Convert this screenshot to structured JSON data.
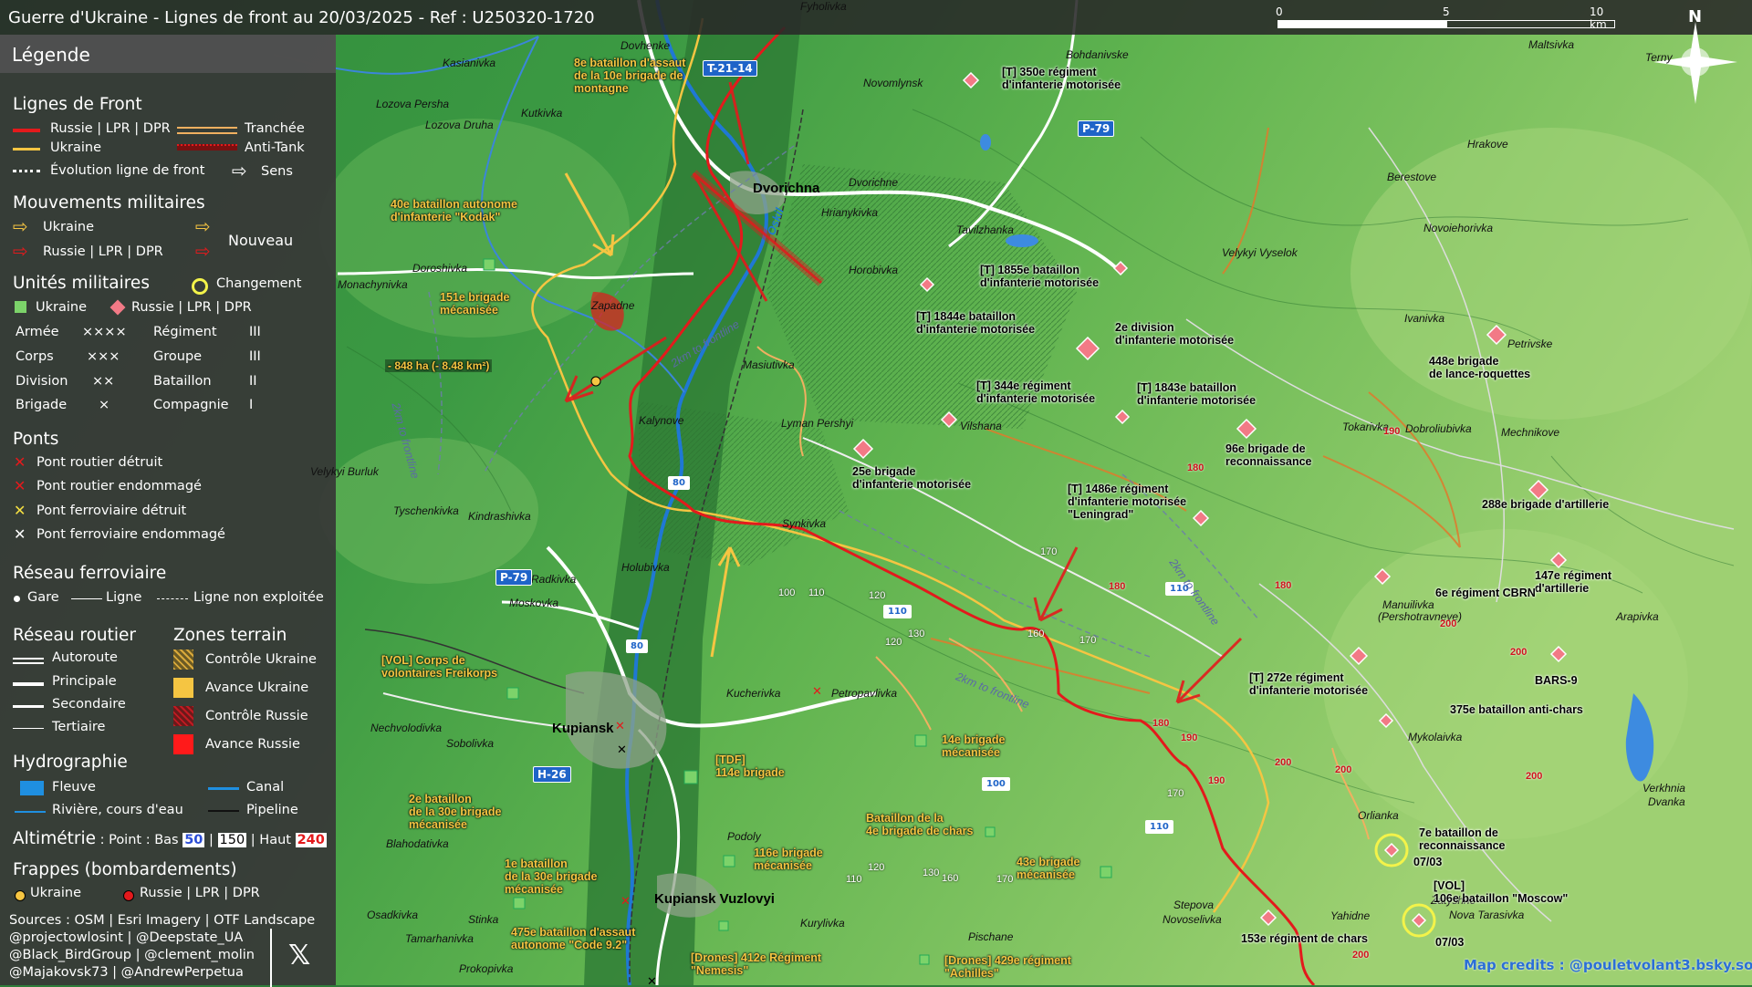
{
  "title": "Guerre d'Ukraine - Lignes de front au 20/03/2025 - Ref : U250320-1720",
  "scale": {
    "ticks": [
      "0",
      "5",
      "10 km"
    ]
  },
  "north": "N",
  "legend": {
    "heading": "Légende",
    "front_lines": {
      "title": "Lignes de Front",
      "russia": "Russie | LPR | DPR",
      "ukraine": "Ukraine",
      "trench": "Tranchée",
      "antitank": "Anti-Tank",
      "evolution": "Évolution ligne de front",
      "direction": "Sens"
    },
    "movements": {
      "title": "Mouvements militaires",
      "ukraine": "Ukraine",
      "russia": "Russie | LPR | DPR",
      "new": "Nouveau"
    },
    "units": {
      "title": "Unités militaires",
      "change": "Changement",
      "ukraine": "Ukraine",
      "russia": "Russie | LPR | DPR",
      "rows": [
        {
          "a": "Armée",
          "as": "××××",
          "b": "Régiment",
          "bs": "III"
        },
        {
          "a": "Corps",
          "as": "×××",
          "b": "Groupe",
          "bs": "III"
        },
        {
          "a": "Division",
          "as": "××",
          "b": "Bataillon",
          "bs": "II"
        },
        {
          "a": "Brigade",
          "as": "×",
          "b": "Compagnie",
          "bs": "I"
        }
      ]
    },
    "bridges": {
      "title": "Ponts",
      "items": [
        "Pont routier détruit",
        "Pont routier endommagé",
        "Pont ferroviaire détruit",
        "Pont ferroviaire endommagé"
      ]
    },
    "rail": {
      "title": "Réseau ferroviaire",
      "station": "Gare",
      "line": "Ligne",
      "unused": "Ligne non exploitée"
    },
    "roads": {
      "title": "Réseau routier",
      "items": [
        "Autoroute",
        "Principale",
        "Secondaire",
        "Tertiaire"
      ]
    },
    "zones": {
      "title": "Zones terrain",
      "items": [
        "Contrôle Ukraine",
        "Avance Ukraine",
        "Contrôle Russie",
        "Avance Russie"
      ]
    },
    "hydro": {
      "title": "Hydrographie",
      "river": "Fleuve",
      "canal": "Canal",
      "stream": "Rivière, cours d'eau",
      "pipeline": "Pipeline"
    },
    "altimetry": {
      "title": "Altimétrie",
      "text": ": Point : Bas",
      "low": "50",
      "sep1": "|",
      "mid": "150",
      "sep2": "| Haut",
      "high": "240"
    },
    "strikes": {
      "title": "Frappes (bombardements)",
      "ukraine": "Ukraine",
      "russia": "Russie | LPR | DPR"
    },
    "sources": [
      "Sources : OSM | Esri Imagery | OTF Landscape",
      "@projectowlosint | @Deepstate_UA",
      "@Black_BirdGroup | @clement_molin",
      "@Majakovsk73 | @AndrewPerpetua"
    ],
    "x_icon": "x-logo-icon"
  },
  "road_badges": [
    "T-21-14",
    "P-79",
    "P-79",
    "H-26",
    "80",
    "80",
    "110",
    "110",
    "110",
    "100"
  ],
  "villages": [
    "Fyholivka",
    "Dovhenke",
    "Kasianivka",
    "Lozova Persha",
    "Lozova Druha",
    "Kutkivka",
    "Novomlynsk",
    "Bohdanivske",
    "Maltsivka",
    "Terny",
    "Hrakove",
    "Berestove",
    "Novoiehorivka",
    "Dvorichne",
    "Hrianykivka",
    "Tavilzhanka",
    "Velykyi Vyselok",
    "Doroshivka",
    "Horobivka",
    "Zapadne",
    "Masiutivka",
    "Ivanivka",
    "Petrivske",
    "Kalynove",
    "Lyman Pershyi",
    "Vilshana",
    "Tokarivka",
    "Mechnikove",
    "Dobroliubivka",
    "Kindrashivka",
    "Tyschenkivka",
    "Synkivka",
    "Holubivka",
    "Radkivka",
    "Moskovka",
    "Manuilivka",
    "(Pershotravneve)",
    "Arapivka",
    "Kucherivka",
    "Petropavlivka",
    "Nechvolodivka",
    "Sobolivka",
    "Mykolaivka",
    "Orlianka",
    "Verkhnia",
    "Dvanka",
    "Blahodativka",
    "Podoly",
    "Kurylivka",
    "Stinka",
    "Osadkivka",
    "Tamarhanivka",
    "Prokopivka",
    "Pischane",
    "Stepova",
    "Novoselivka",
    "Yahidne",
    "Zatyshne",
    "Nova Tarasivka",
    "Monachynivka",
    "Velykyi Burluk"
  ],
  "towns": [
    "Dvorichna",
    "Kupiansk",
    "Kupiansk Vuzlovyi"
  ],
  "ukraine_units": [
    "8e bataillon d'assaut\nde la 10e brigade de\nmontagne",
    "40e bataillon autonome\nd'infanterie \"Kodak\"",
    "151e brigade\nmécanisée",
    "[VOL] Corps de\nvolontaires Freikorps",
    "[TDF]\n114e brigade",
    "116e brigade\nmécanisée",
    "2e bataillon\nde la 30e brigade\nmécanisée",
    "1e bataillon\nde la 30e brigade\nmécanisée",
    "475e bataillon d'assaut\nautonome \"Code 9.2\"",
    "[Drones] 412e Régiment\n\"Nemesis\"",
    "[Drones] 429e régiment\n\"Achilles\"",
    "14e brigade\nmécanisée",
    "Bataillon de la\n4e brigade de chars",
    "43e brigade\nmécanisée"
  ],
  "russia_units": [
    "[T] 350e régiment\nd'infanterie motorisée",
    "[T] 1855e bataillon\nd'infanterie motorisée",
    "[T] 1844e bataillon\nd'infanterie motorisée",
    "2e division\nd'infanterie motorisée",
    "[T] 344e régiment\nd'infanterie motorisée",
    "[T] 1843e bataillon\nd'infanterie motorisée",
    "25e brigade\nd'infanterie motorisée",
    "96e brigade de\nreconnaissance",
    "[T] 1486e régiment\nd'infanterie motorisée\n\"Leningrad\"",
    "448e brigade\nde lance-roquettes",
    "288e brigade d'artillerie",
    "147e régiment\nd'artillerie",
    "6e régiment CBRN",
    "BARS-9",
    "[T] 272e régiment\nd'infanterie motorisée",
    "375e bataillon anti-chars",
    "7e bataillon de\nreconnaissance",
    "[VOL]\n106e bataillon \"Moscow\"",
    "153e régiment de chars"
  ],
  "dates": [
    "07/03",
    "07/03"
  ],
  "area_note": "- 848 ha (- 8.48 km²)",
  "frontline_notes": [
    "2km to frontline",
    "2km to frontline",
    "2km to frontline",
    "2km to frontline"
  ],
  "river_name": "Oskil",
  "spot_heights": [
    "190",
    "180",
    "180",
    "180",
    "200",
    "200",
    "200",
    "200",
    "200",
    "170",
    "160",
    "170",
    "180",
    "190",
    "190",
    "170",
    "100",
    "110",
    "120",
    "120",
    "130",
    "120",
    "130",
    "160",
    "170",
    "110",
    "200"
  ],
  "credit": "Map credits : @pouletvolant3.bsky.social",
  "colors": {
    "russia": "#e31a1c",
    "ukraine": "#f5c542",
    "panel": "#3a3a3a",
    "river": "#1f78d4"
  }
}
